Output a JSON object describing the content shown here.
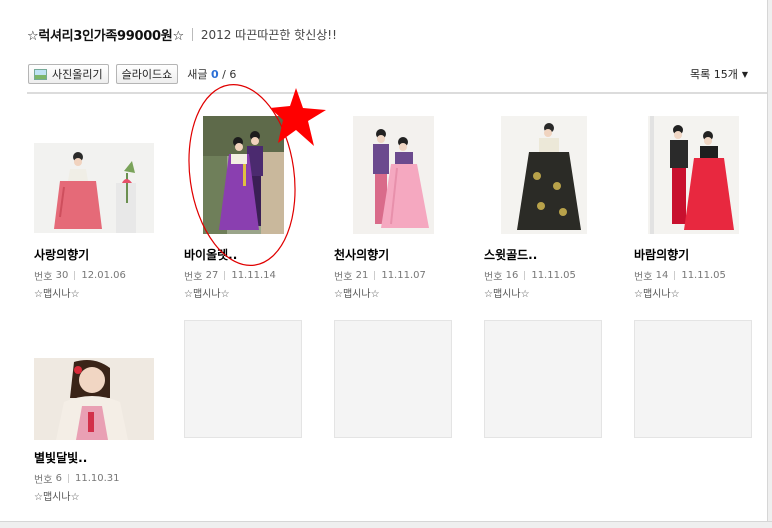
{
  "board": {
    "title": "☆럭셔리3인가족99000원☆",
    "description": "2012 따끈따끈한 핫신상!!"
  },
  "toolbar": {
    "upload_label": "사진올리기",
    "slideshow_label": "슬라이드쇼",
    "new_label": "새글",
    "new_count": "0",
    "total_separator": "/",
    "total_count": "6",
    "list_size_label": "목록 15개",
    "upload_icon": "photo-icon",
    "dropdown_icon": "caret-down-icon"
  },
  "meta_prefix": "번호",
  "photos": [
    {
      "title": "사랑의향기",
      "number": "30",
      "date": "12.01.06",
      "author": "☆맵시나☆"
    },
    {
      "title": "바이올렛..",
      "number": "27",
      "date": "11.11.14",
      "author": "☆맵시나☆"
    },
    {
      "title": "천사의향기",
      "number": "21",
      "date": "11.11.07",
      "author": "☆맵시나☆"
    },
    {
      "title": "스윗골드..",
      "number": "16",
      "date": "11.11.05",
      "author": "☆맵시나☆"
    },
    {
      "title": "바람의향기",
      "number": "14",
      "date": "11.11.05",
      "author": "☆맵시나☆"
    },
    {
      "title": "별빛달빛..",
      "number": "6",
      "date": "11.10.31",
      "author": "☆맵시나☆"
    }
  ],
  "colors": {
    "accent_blue": "#2b6fd6",
    "annotation_red": "#e00000"
  }
}
